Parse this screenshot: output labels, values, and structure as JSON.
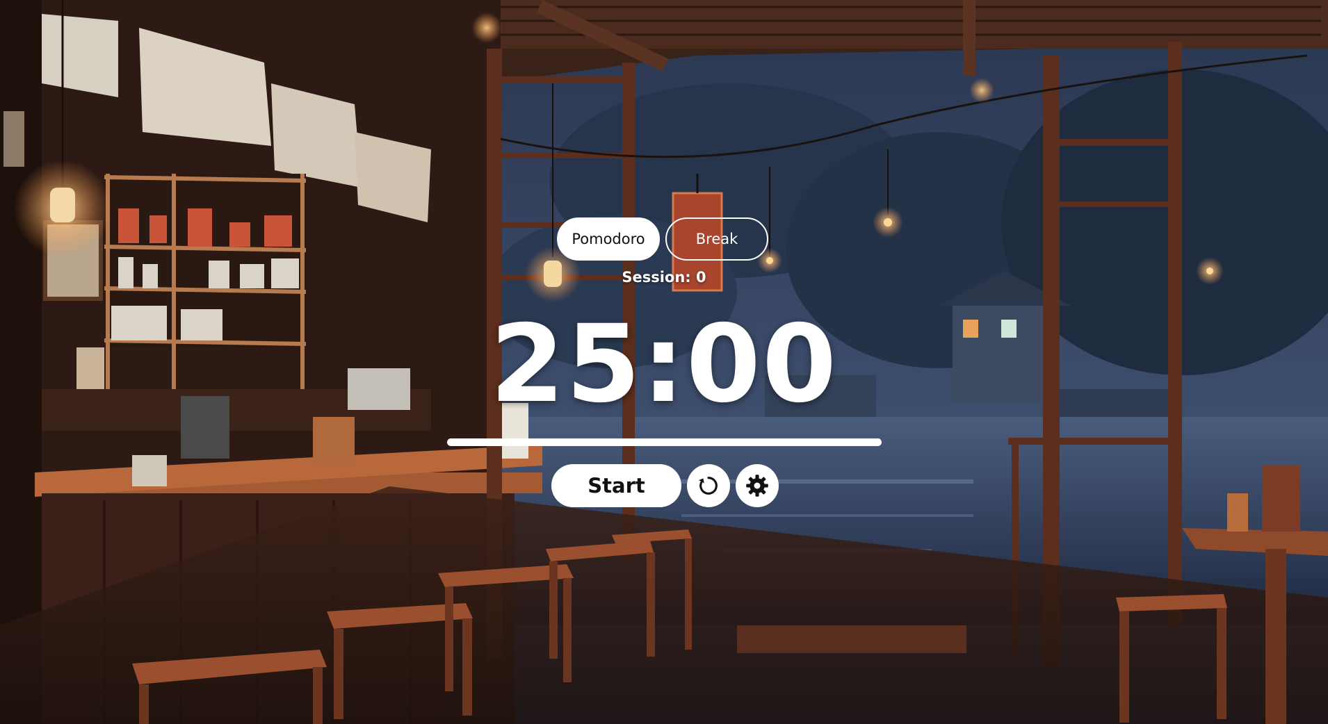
{
  "modes": {
    "pomodoro_label": "Pomodoro",
    "break_label": "Break",
    "active": "Pomodoro"
  },
  "session": {
    "prefix": "Session:",
    "count": "0"
  },
  "timer": {
    "display": "25:00",
    "progress_fraction": 1.0
  },
  "controls": {
    "start_label": "Start",
    "reset_icon": "reset-icon",
    "settings_icon": "gear-icon"
  },
  "background": {
    "scene": "cozy riverside cafe at night"
  },
  "colors": {
    "accent": "#ffffff",
    "text_dark": "#111111",
    "night_sky": "#2b3a55",
    "wood": "#6b3a22",
    "lamp_glow": "#ffb066"
  }
}
